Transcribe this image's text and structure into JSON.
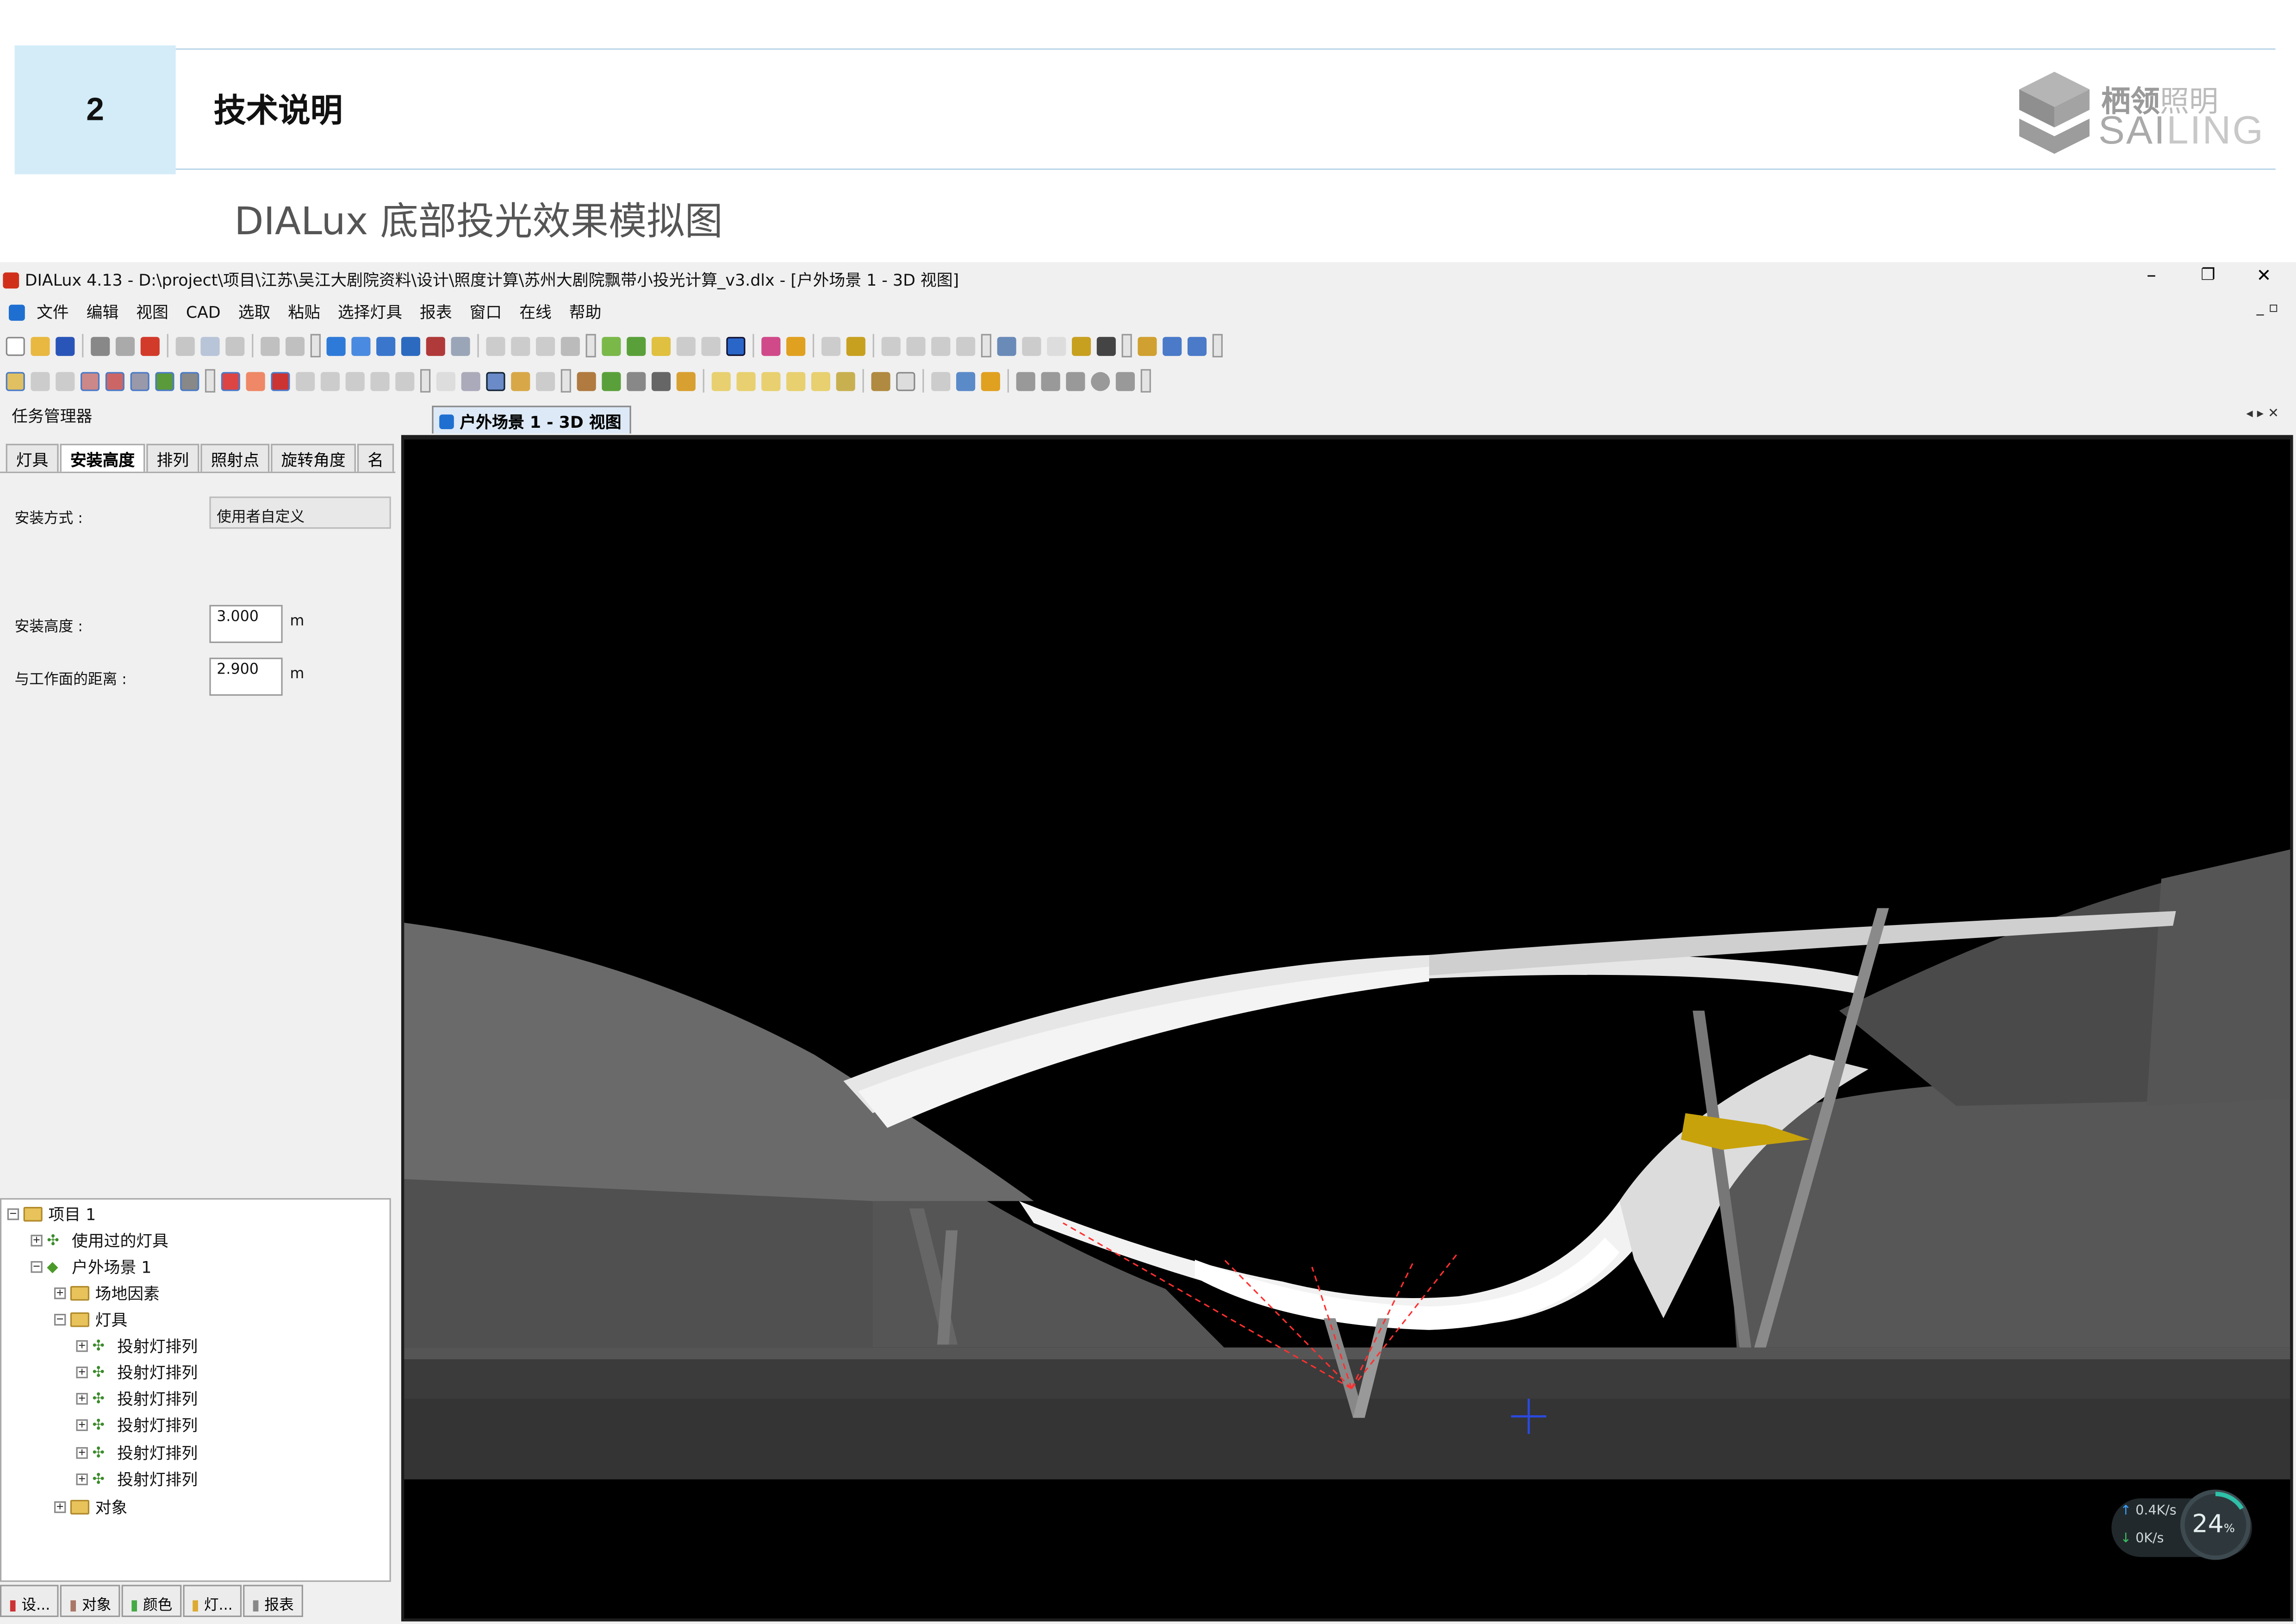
{
  "slide": {
    "section_number": "2",
    "section_title": "技术说明",
    "subtitle": "DIALux 底部投光效果模拟图",
    "logo": {
      "cn_bold": "栖领",
      "cn_light": "照明",
      "en_dark": "SAI",
      "en_light": "LING"
    }
  },
  "window": {
    "title": "DIALux 4.13 - D:\\project\\项目\\江苏\\吴江大剧院资料\\设计\\照度计算\\苏州大剧院飘带小投光计算_v3.dlx - [户外场景 1 - 3D 视图]",
    "controls": [
      "–",
      "❐",
      "✕"
    ]
  },
  "menu": [
    "文件",
    "编辑",
    "视图",
    "CAD",
    "选取",
    "粘贴",
    "选择灯具",
    "报表",
    "窗口",
    "在线",
    "帮助"
  ],
  "task_panel": {
    "header": "任务管理器",
    "tabs": [
      "灯具",
      "安装高度",
      "排列",
      "照射点",
      "旋转角度",
      "名"
    ],
    "active_tab": "安装高度",
    "mount_type_label": "安装方式 :",
    "mount_type_value": "使用者自定义",
    "height_label": "安装高度 :",
    "height_value": "3.000",
    "height_unit": "m",
    "distance_label": "与工作面的距离 :",
    "distance_value": "2.900",
    "distance_unit": "m"
  },
  "tree": {
    "project": "项目 1",
    "used_luminaires": "使用过的灯具",
    "scene": "户外场景 1",
    "site": "场地因素",
    "luminaires": "灯具",
    "arrays": [
      "投射灯排列",
      "投射灯排列",
      "投射灯排列",
      "投射灯排列",
      "投射灯排列",
      "投射灯排列"
    ],
    "objects": "对象"
  },
  "bottom_tabs": [
    "设...",
    "对象",
    "颜色",
    "灯...",
    "报表"
  ],
  "view": {
    "tab_label": "户外场景 1 - 3D 视图",
    "net_up": "0.4K/s",
    "net_down": "0K/s",
    "cpu": "24",
    "cpu_unit": "%"
  },
  "colors": {
    "accent": "#d3ecf8",
    "tab_active": "#dde9f6",
    "viewport_bg": "#000000"
  }
}
